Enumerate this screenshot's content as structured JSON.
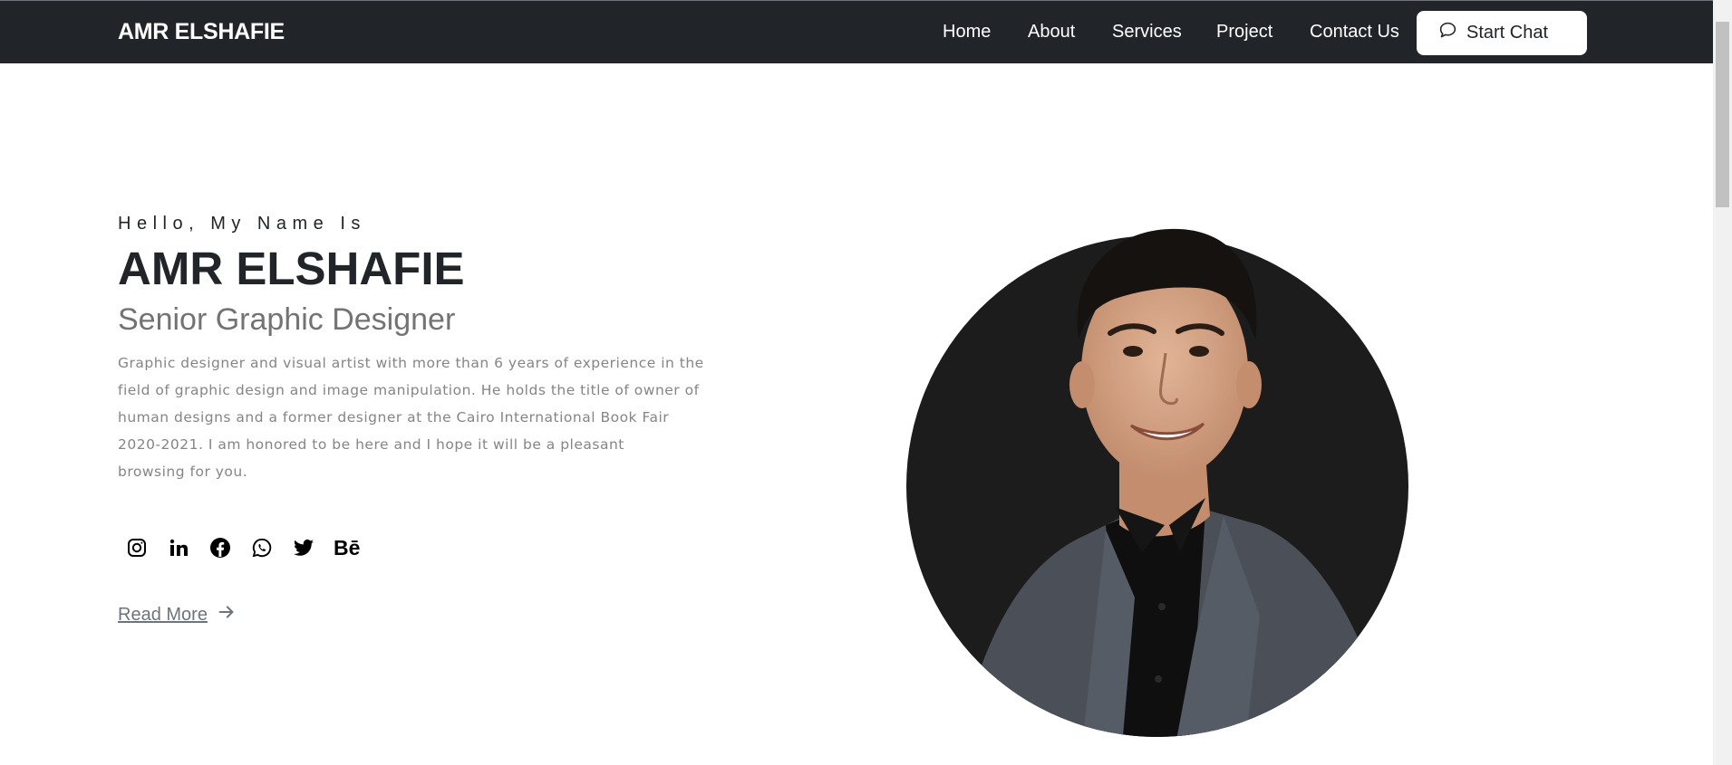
{
  "navbar": {
    "brand": "AMR ELSHAFIE",
    "links": [
      "Home",
      "About",
      "Services",
      "Project",
      "Contact Us"
    ],
    "chat_button": "Start Chat"
  },
  "hero": {
    "greeting": "Hello, My Name Is",
    "name": "AMR ELSHAFIE",
    "role": "Senior Graphic Designer",
    "description_lines": [
      "Graphic designer and visual artist with more than 6 years of experience in the",
      "field of graphic design and image manipulation. He holds the title of owner of",
      "human designs and a former designer at the Cairo International Book Fair",
      "2020-2021. I am honored to be here and I hope it will be a pleasant",
      "browsing for you."
    ],
    "social": {
      "icons": [
        "instagram-icon",
        "linkedin-icon",
        "facebook-icon",
        "whatsapp-icon",
        "twitter-icon",
        "behance-icon"
      ],
      "behance_text": "Bē"
    },
    "read_more": "Read More"
  },
  "colors": {
    "navbar_bg": "#212529",
    "text_dark": "#212529",
    "text_muted": "#737373",
    "portrait_circle": "#1c1c1c",
    "jacket": "#4b5058"
  }
}
